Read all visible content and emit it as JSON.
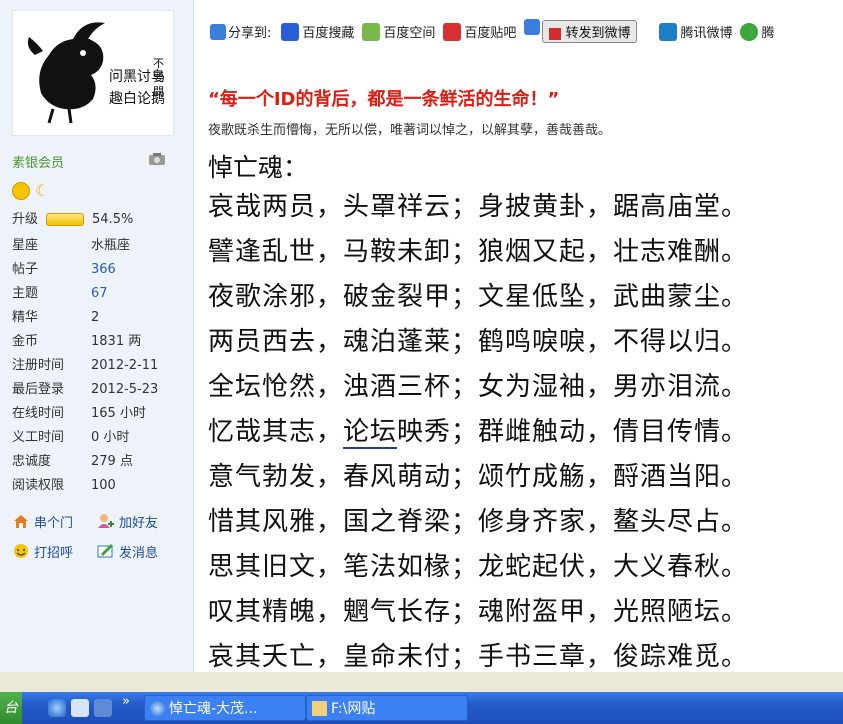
{
  "sidebar": {
    "rank": "素银会员",
    "upgrade_label": "升级",
    "upgrade_percent": "54.5%",
    "upgrade_progress": 0.545,
    "stats": [
      {
        "key": "星座",
        "value": "水瓶座",
        "link": false
      },
      {
        "key": "帖子",
        "value": "366",
        "link": true
      },
      {
        "key": "主题",
        "value": "67",
        "link": true
      },
      {
        "key": "精华",
        "value": "2",
        "link": false
      },
      {
        "key": "金币",
        "value": "1831 两",
        "link": false
      },
      {
        "key": "注册时间",
        "value": "2012-2-11",
        "link": false
      },
      {
        "key": "最后登录",
        "value": "2012-5-23",
        "link": false
      },
      {
        "key": "在线时间",
        "value": "165 小时",
        "link": false
      },
      {
        "key": "义工时间",
        "value": "0 小时",
        "link": false
      },
      {
        "key": "忠诚度",
        "value": "279 点",
        "link": false
      },
      {
        "key": "阅读权限",
        "value": "100",
        "link": false
      }
    ],
    "actions": [
      "串个门",
      "加好友",
      "打招呼",
      "发消息"
    ]
  },
  "share": {
    "label": "分享到:",
    "items": [
      "百度搜藏",
      "百度空间",
      "百度贴吧"
    ],
    "weibo_button": "转发到微博",
    "tencent": "腾讯微博",
    "more": "腾"
  },
  "post": {
    "quote": "“每一个ID的背后，都是一条鲜活的生命！”",
    "subtitle": "夜歌既杀生而懵悔，无所以偿，唯著词以悼之，以解其孽，善哉善哉。",
    "title": "悼亡魂：",
    "lines": [
      "哀哉两员，头罩祥云；身披黄卦，踞高庙堂。",
      "譬逢乱世，马鞍未卸；狼烟又起，壮志难酬。",
      "夜歌涂邪，破金裂甲；文星低坠，武曲蒙尘。",
      "两员西去，魂泊蓬莱；鹤鸣唳唳，不得以归。",
      "全坛怆然，浊酒三杯；女为湿袖，男亦泪流。",
      "意气勃发，春风萌动；颂竹成觞，酹酒当阳。",
      "惜其风雅，国之脊梁；修身齐家，鳌头尽占。",
      "思其旧文，笔法如椽；龙蛇起伏，大义春秋。",
      "叹其精魄，魍气长存；魂附盔甲，光照陋坛。",
      "哀其夭亡，皇命未付；手书三章，俊踪难觅。"
    ],
    "line6": {
      "pre": "忆哉其志，",
      "link": "论坛",
      "post": "映秀；群雌触动，倩目传情。"
    }
  },
  "taskbar": {
    "start": "台",
    "chevron": "»",
    "task1": "悼亡魂-大茂...",
    "task2": "F:\\网贴"
  }
}
